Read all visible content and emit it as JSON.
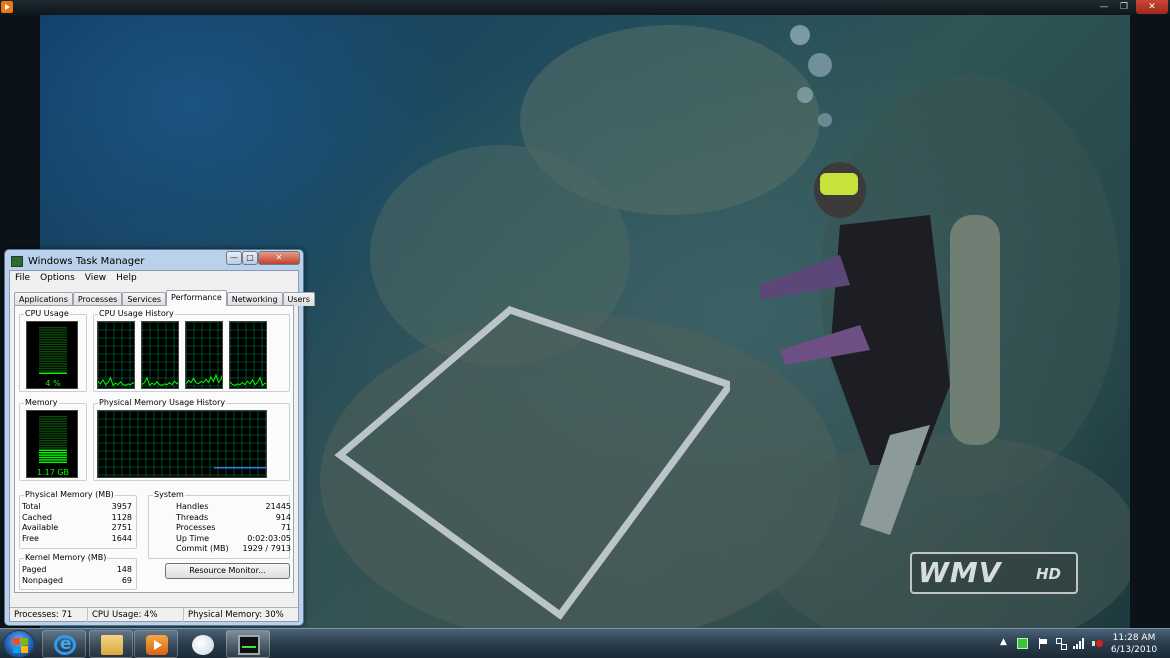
{
  "player": {
    "window_controls": {
      "minimize": "—",
      "maximize": "❐",
      "close": "✕"
    },
    "watermark": {
      "text": "WMV",
      "badge": "HD"
    }
  },
  "task_manager": {
    "title": "Windows Task Manager",
    "window_controls": {
      "minimize": "—",
      "maximize": "□",
      "close": "✕"
    },
    "menu": [
      "File",
      "Options",
      "View",
      "Help"
    ],
    "tabs": [
      "Applications",
      "Processes",
      "Services",
      "Performance",
      "Networking",
      "Users"
    ],
    "active_tab": "Performance",
    "cpu_usage": {
      "label": "CPU Usage",
      "value": "4 %",
      "level": 0.04
    },
    "cpu_history": {
      "label": "CPU Usage History",
      "cores": 4
    },
    "memory": {
      "label": "Memory",
      "value": "1.17 GB",
      "level": 0.3
    },
    "memory_history": {
      "label": "Physical Memory Usage History",
      "level": 0.3
    },
    "physical_memory": {
      "label": "Physical Memory (MB)",
      "rows": [
        {
          "name": "Total",
          "value": "3957"
        },
        {
          "name": "Cached",
          "value": "1128"
        },
        {
          "name": "Available",
          "value": "2751"
        },
        {
          "name": "Free",
          "value": "1644"
        }
      ]
    },
    "kernel_memory": {
      "label": "Kernel Memory (MB)",
      "rows": [
        {
          "name": "Paged",
          "value": "148"
        },
        {
          "name": "Nonpaged",
          "value": "69"
        }
      ]
    },
    "system": {
      "label": "System",
      "rows": [
        {
          "name": "Handles",
          "value": "21445"
        },
        {
          "name": "Threads",
          "value": "914"
        },
        {
          "name": "Processes",
          "value": "71"
        },
        {
          "name": "Up Time",
          "value": "0:02:03:05"
        },
        {
          "name": "Commit (MB)",
          "value": "1929 / 7913"
        }
      ]
    },
    "resource_monitor_button": "Resource Monitor...",
    "status": {
      "processes": "Processes: 71",
      "cpu": "CPU Usage: 4%",
      "memory": "Physical Memory: 30%"
    },
    "graph_color": "#00ff00",
    "grid_color": "#008040"
  },
  "taskbar": {
    "pinned": [
      "windows-logo-icon",
      "internet-explorer-icon",
      "file-explorer-icon",
      "media-player-icon",
      "paint-icon",
      "task-manager-icon"
    ],
    "tray_arrow": "▲",
    "clock": {
      "time": "11:28 AM",
      "date": "6/13/2010"
    }
  }
}
